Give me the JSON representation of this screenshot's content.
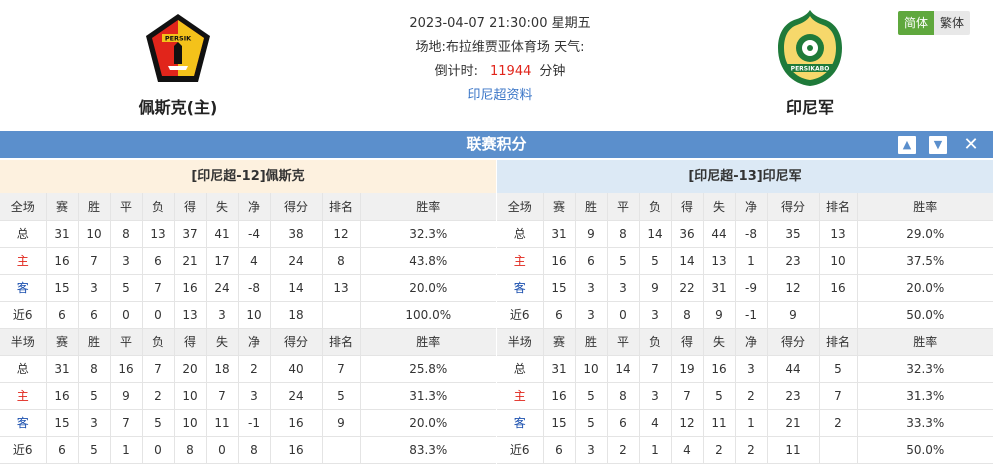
{
  "header": {
    "home_team": "佩斯克(主)",
    "away_team": "印尼军",
    "datetime": "2023-04-07 21:30:00 星期五",
    "venue_label": "场地:",
    "venue": "布拉维贾亚体育场",
    "weather_label": "天气:",
    "countdown_label": "倒计时:",
    "countdown_value": "11944",
    "countdown_unit": "分钟",
    "league_link": "印尼超资料",
    "home_logo_text": "PERSIK",
    "away_logo_text": "PERSIKABO"
  },
  "lang": {
    "simplified": "简体",
    "traditional": "繁体"
  },
  "section": {
    "title": "联赛积分",
    "up_icon": "arrow-up-icon",
    "down_icon": "arrow-down-icon",
    "close_icon": "close-icon"
  },
  "colors": {
    "bar": "#5b8fcc",
    "home_tint": "#fdf1df",
    "away_tint": "#dce9f5",
    "red": "#e1251b",
    "blue": "#1a4fae",
    "green": "#5fa83d"
  },
  "panels": [
    {
      "title": "[印尼超-12]佩斯克",
      "full_header": [
        "全场",
        "赛",
        "胜",
        "平",
        "负",
        "得",
        "失",
        "净",
        "得分",
        "排名",
        "胜率"
      ],
      "full_rows": [
        [
          "总",
          "31",
          "10",
          "8",
          "13",
          "37",
          "41",
          "-4",
          "38",
          "12",
          "32.3%"
        ],
        [
          "主",
          "16",
          "7",
          "3",
          "6",
          "21",
          "17",
          "4",
          "24",
          "8",
          "43.8%"
        ],
        [
          "客",
          "15",
          "3",
          "5",
          "7",
          "16",
          "24",
          "-8",
          "14",
          "13",
          "20.0%"
        ],
        [
          "近6",
          "6",
          "6",
          "0",
          "0",
          "13",
          "3",
          "10",
          "18",
          "",
          "100.0%"
        ]
      ],
      "half_header": [
        "半场",
        "赛",
        "胜",
        "平",
        "负",
        "得",
        "失",
        "净",
        "得分",
        "排名",
        "胜率"
      ],
      "half_rows": [
        [
          "总",
          "31",
          "8",
          "16",
          "7",
          "20",
          "18",
          "2",
          "40",
          "7",
          "25.8%"
        ],
        [
          "主",
          "16",
          "5",
          "9",
          "2",
          "10",
          "7",
          "3",
          "24",
          "5",
          "31.3%"
        ],
        [
          "客",
          "15",
          "3",
          "7",
          "5",
          "10",
          "11",
          "-1",
          "16",
          "9",
          "20.0%"
        ],
        [
          "近6",
          "6",
          "5",
          "1",
          "0",
          "8",
          "0",
          "8",
          "16",
          "",
          "83.3%"
        ]
      ]
    },
    {
      "title": "[印尼超-13]印尼军",
      "full_header": [
        "全场",
        "赛",
        "胜",
        "平",
        "负",
        "得",
        "失",
        "净",
        "得分",
        "排名",
        "胜率"
      ],
      "full_rows": [
        [
          "总",
          "31",
          "9",
          "8",
          "14",
          "36",
          "44",
          "-8",
          "35",
          "13",
          "29.0%"
        ],
        [
          "主",
          "16",
          "6",
          "5",
          "5",
          "14",
          "13",
          "1",
          "23",
          "10",
          "37.5%"
        ],
        [
          "客",
          "15",
          "3",
          "3",
          "9",
          "22",
          "31",
          "-9",
          "12",
          "16",
          "20.0%"
        ],
        [
          "近6",
          "6",
          "3",
          "0",
          "3",
          "8",
          "9",
          "-1",
          "9",
          "",
          "50.0%"
        ]
      ],
      "half_header": [
        "半场",
        "赛",
        "胜",
        "平",
        "负",
        "得",
        "失",
        "净",
        "得分",
        "排名",
        "胜率"
      ],
      "half_rows": [
        [
          "总",
          "31",
          "10",
          "14",
          "7",
          "19",
          "16",
          "3",
          "44",
          "5",
          "32.3%"
        ],
        [
          "主",
          "16",
          "5",
          "8",
          "3",
          "7",
          "5",
          "2",
          "23",
          "7",
          "31.3%"
        ],
        [
          "客",
          "15",
          "5",
          "6",
          "4",
          "12",
          "11",
          "1",
          "21",
          "2",
          "33.3%"
        ],
        [
          "近6",
          "6",
          "3",
          "2",
          "1",
          "4",
          "2",
          "2",
          "11",
          "",
          "50.0%"
        ]
      ]
    }
  ]
}
